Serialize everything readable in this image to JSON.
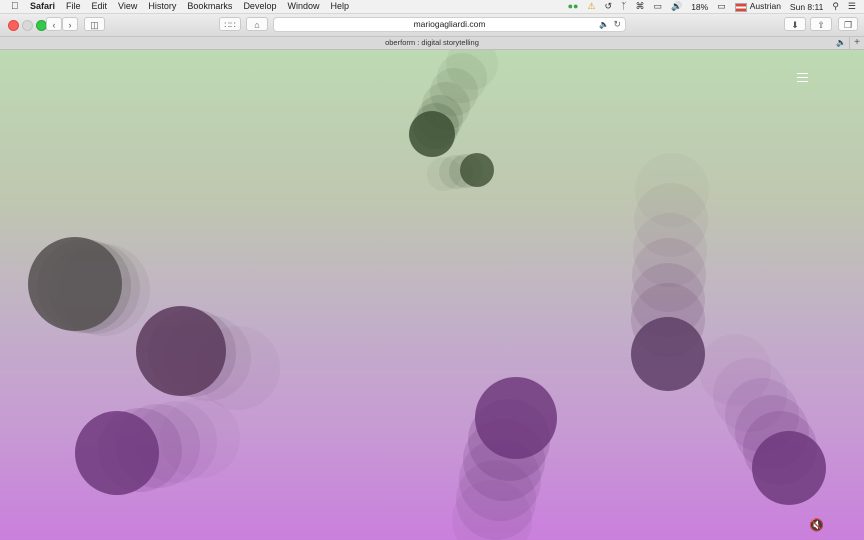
{
  "menubar": {
    "apple": "",
    "app": "Safari",
    "items": [
      "File",
      "Edit",
      "View",
      "History",
      "Bookmarks",
      "Develop",
      "Window",
      "Help"
    ],
    "battery": "18%",
    "input_source": "Austrian",
    "clock": "Sun 8:11"
  },
  "toolbar": {
    "url": "mariogagliardi.com"
  },
  "tab": {
    "title": "oberform : digital storytelling",
    "plus": "+"
  },
  "colors": {
    "green_ball": "#3e5034",
    "gray_ball": "#555050",
    "purple_ball": "#6e3a7c"
  }
}
